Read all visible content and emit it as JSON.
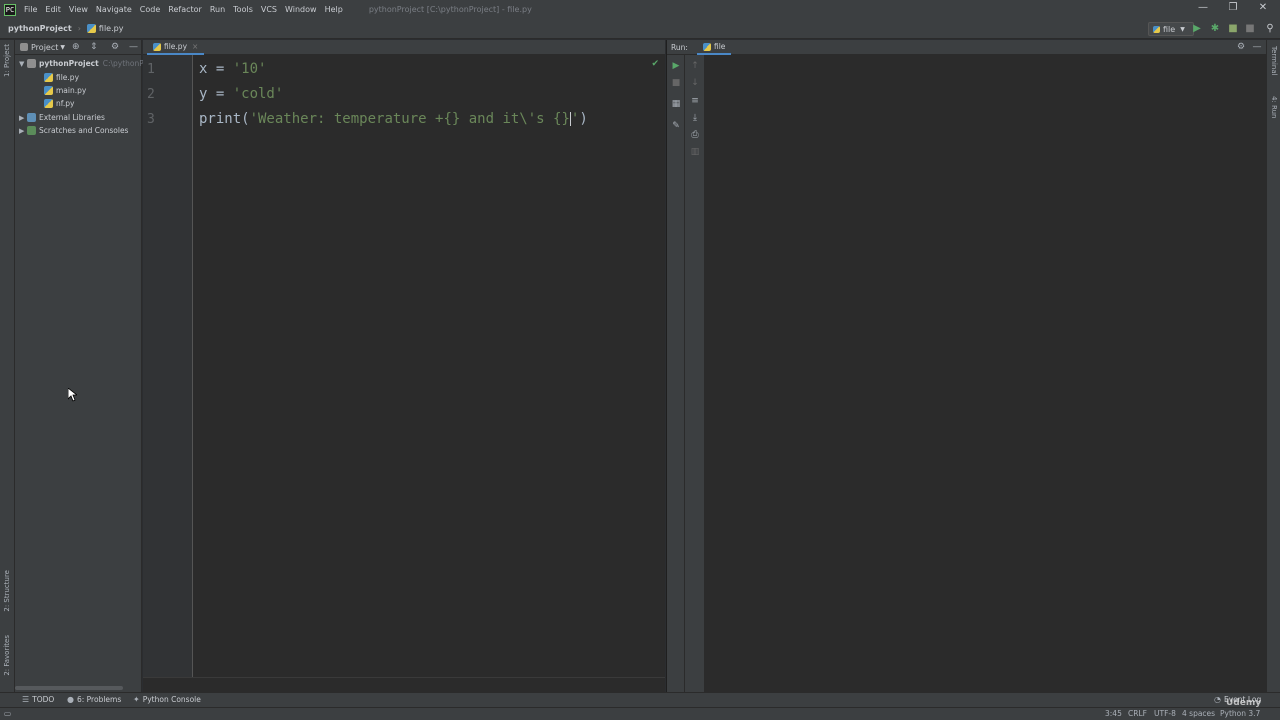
{
  "app": {
    "window_title": "pythonProject [C:\\pythonProject] - file.py",
    "logo": "PC"
  },
  "menu": [
    "File",
    "Edit",
    "View",
    "Navigate",
    "Code",
    "Refactor",
    "Run",
    "Tools",
    "VCS",
    "Window",
    "Help"
  ],
  "window_controls": {
    "minimize": "—",
    "maximize": "❐",
    "close": "✕"
  },
  "navbar": {
    "project": "pythonProject",
    "file": "file.py",
    "run_config": "file"
  },
  "left_stripe": {
    "project": "1: Project",
    "structure": "2: Structure",
    "favorites": "2: Favorites"
  },
  "project_pane": {
    "title": "Project",
    "root": {
      "label": "pythonProject",
      "path": "C:\\pythonPr"
    },
    "files": [
      "file.py",
      "main.py",
      "nf.py"
    ],
    "external_libraries": "External Libraries",
    "scratches": "Scratches and Consoles"
  },
  "editor": {
    "tab": "file.py",
    "line_numbers": [
      "1",
      "2",
      "3"
    ],
    "lines": [
      {
        "a": "x = ",
        "b": "'10'",
        "c": "",
        "d": ""
      },
      {
        "a": "y = ",
        "b": "'cold'",
        "c": "",
        "d": ""
      },
      {
        "a": "print(",
        "b": "'Weather: temperature +{} and it\\'s {}",
        "c": "'",
        "d": ")"
      }
    ]
  },
  "run": {
    "label": "Run:",
    "tab": "file"
  },
  "right_stripe": {
    "terminal": "Terminal",
    "run": "4: Run"
  },
  "bottom_bar": {
    "todo": "TODO",
    "problems": "6: Problems",
    "python_console": "Python Console",
    "event_log": "Event Log"
  },
  "status_bar": {
    "position": "3:45",
    "line_sep": "CRLF",
    "encoding": "UTF-8",
    "indent": "4 spaces",
    "interpreter": "Python 3.7"
  },
  "watermark": "Udemy"
}
